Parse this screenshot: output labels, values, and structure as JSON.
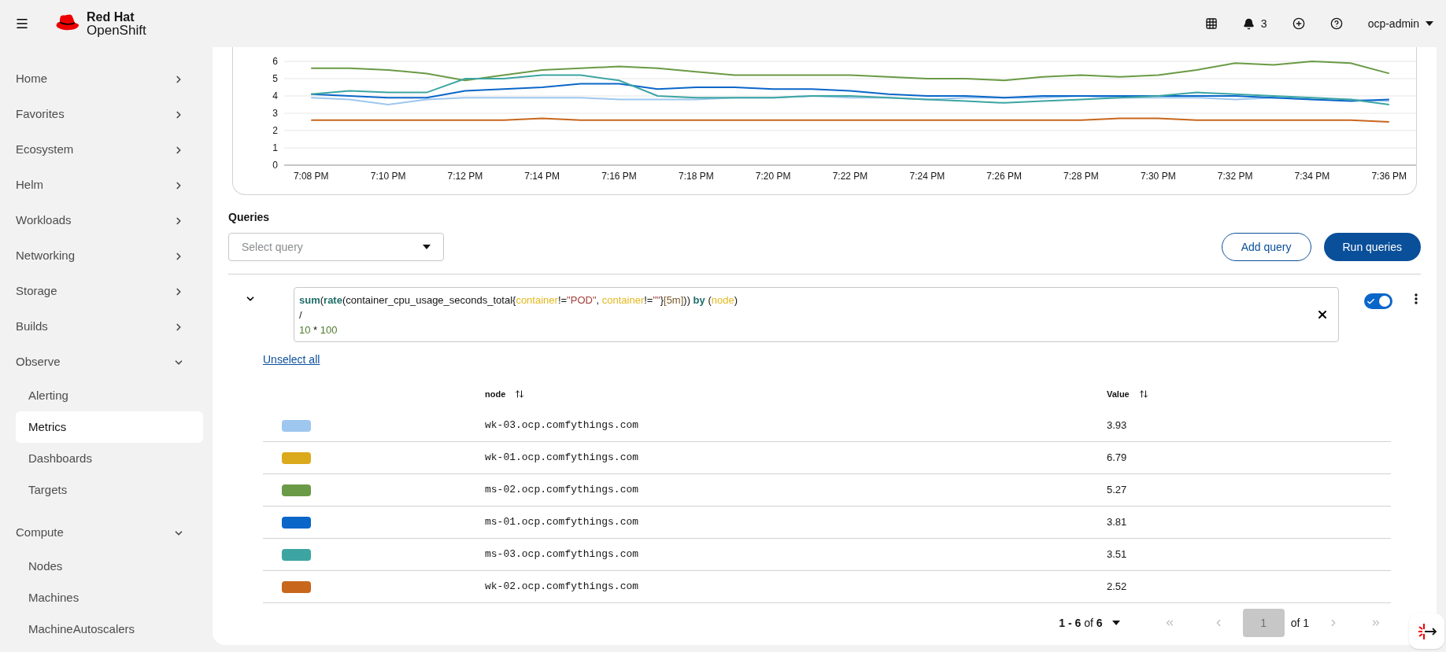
{
  "header": {
    "brand_top": "Red Hat",
    "brand_bottom": "OpenShift",
    "notifications": "3",
    "user": "ocp-admin"
  },
  "sidebar": {
    "items": [
      {
        "label": "Home",
        "expanded": false
      },
      {
        "label": "Favorites",
        "expanded": false
      },
      {
        "label": "Ecosystem",
        "expanded": false
      },
      {
        "label": "Helm",
        "expanded": false
      },
      {
        "label": "Workloads",
        "expanded": false
      },
      {
        "label": "Networking",
        "expanded": false
      },
      {
        "label": "Storage",
        "expanded": false
      },
      {
        "label": "Builds",
        "expanded": false
      },
      {
        "label": "Observe",
        "expanded": true,
        "children": [
          {
            "label": "Alerting",
            "selected": false
          },
          {
            "label": "Metrics",
            "selected": true
          },
          {
            "label": "Dashboards",
            "selected": false
          },
          {
            "label": "Targets",
            "selected": false
          }
        ]
      },
      {
        "label": "Compute",
        "expanded": true,
        "children": [
          {
            "label": "Nodes",
            "selected": false
          },
          {
            "label": "Machines",
            "selected": false
          },
          {
            "label": "MachineAutoscalers",
            "selected": false
          }
        ]
      }
    ]
  },
  "chart": {
    "chart_data": {
      "type": "line",
      "grid": true,
      "ylim": [
        0,
        6
      ],
      "yticks": [
        0,
        1,
        2,
        3,
        4,
        5,
        6
      ],
      "categories": [
        "7:08 PM",
        null,
        "7:10 PM",
        null,
        "7:12 PM",
        null,
        "7:14 PM",
        null,
        "7:16 PM",
        null,
        "7:18 PM",
        null,
        "7:20 PM",
        null,
        "7:22 PM",
        null,
        "7:24 PM",
        null,
        "7:26 PM",
        null,
        "7:28 PM",
        null,
        "7:30 PM",
        null,
        "7:32 PM",
        null,
        "7:34 PM",
        null,
        "7:36 PM"
      ],
      "series": [
        {
          "color": "#9ec7ef",
          "values": [
            3.9,
            3.8,
            3.5,
            3.8,
            3.9,
            3.9,
            3.9,
            3.9,
            3.8,
            3.8,
            3.8,
            3.9,
            3.9,
            4.0,
            3.9,
            3.9,
            3.8,
            3.9,
            3.9,
            3.9,
            4.0,
            3.9,
            3.9,
            3.9,
            3.8,
            3.9,
            3.8,
            3.8,
            3.7
          ]
        },
        {
          "color": "#6a9a45",
          "values": [
            5.6,
            5.6,
            5.5,
            5.3,
            4.9,
            5.2,
            5.5,
            5.6,
            5.7,
            5.6,
            5.4,
            5.2,
            5.2,
            5.2,
            5.2,
            5.1,
            5.0,
            5.0,
            4.9,
            5.1,
            5.2,
            5.1,
            5.2,
            5.5,
            5.9,
            5.8,
            6.0,
            5.9,
            5.3
          ]
        },
        {
          "color": "#0a66c9",
          "values": [
            4.1,
            4.0,
            3.9,
            3.9,
            4.3,
            4.4,
            4.5,
            4.7,
            4.7,
            4.4,
            4.5,
            4.5,
            4.4,
            4.4,
            4.3,
            4.1,
            4.0,
            4.0,
            3.9,
            4.0,
            4.0,
            4.0,
            4.0,
            4.0,
            4.0,
            3.9,
            3.8,
            3.7,
            3.8
          ]
        },
        {
          "color": "#3ca5a2",
          "values": [
            4.1,
            4.3,
            4.2,
            4.2,
            5.0,
            5.0,
            5.2,
            5.2,
            4.9,
            4.0,
            3.9,
            3.9,
            3.9,
            4.0,
            4.0,
            3.9,
            3.8,
            3.7,
            3.6,
            3.7,
            3.8,
            3.9,
            4.0,
            4.2,
            4.1,
            4.0,
            3.9,
            3.8,
            3.5
          ]
        },
        {
          "color": "#c8661c",
          "values": [
            2.6,
            2.6,
            2.6,
            2.6,
            2.6,
            2.6,
            2.7,
            2.6,
            2.6,
            2.6,
            2.6,
            2.6,
            2.6,
            2.6,
            2.6,
            2.6,
            2.6,
            2.6,
            2.6,
            2.6,
            2.6,
            2.7,
            2.7,
            2.6,
            2.6,
            2.6,
            2.6,
            2.6,
            2.5
          ]
        }
      ]
    }
  },
  "queries": {
    "label": "Queries",
    "select_placeholder": "Select query",
    "add_button": "Add query",
    "run_button": "Run queries",
    "query": {
      "expanded": true,
      "enabled": true,
      "lines": [
        [
          {
            "kind": "function",
            "text": "sum"
          },
          {
            "kind": "plain",
            "text": "("
          },
          {
            "kind": "function",
            "text": "rate"
          },
          {
            "kind": "plain",
            "text": "(container_cpu_usage_seconds_total{"
          },
          {
            "kind": "label",
            "text": "container"
          },
          {
            "kind": "plain",
            "text": "!="
          },
          {
            "kind": "string",
            "text": "\"POD\""
          },
          {
            "kind": "plain",
            "text": ", "
          },
          {
            "kind": "label",
            "text": "container"
          },
          {
            "kind": "plain",
            "text": "!="
          },
          {
            "kind": "string",
            "text": "\"\""
          },
          {
            "kind": "plain",
            "text": "}"
          },
          {
            "kind": "duration",
            "text": "[5m]"
          },
          {
            "kind": "plain",
            "text": ")) "
          },
          {
            "kind": "function",
            "text": "by"
          },
          {
            "kind": "plain",
            "text": " ("
          },
          {
            "kind": "label",
            "text": "node"
          },
          {
            "kind": "plain",
            "text": ")"
          }
        ],
        [
          {
            "kind": "plain",
            "text": "/"
          }
        ],
        [
          {
            "kind": "number",
            "text": "10"
          },
          {
            "kind": "plain",
            "text": " * "
          },
          {
            "kind": "number",
            "text": "100"
          }
        ]
      ]
    }
  },
  "results": {
    "unselect_all": "Unselect all",
    "columns": [
      "node",
      "Value"
    ],
    "rows": [
      {
        "color": "#9ec7ef",
        "node": "wk-03.ocp.comfythings.com",
        "value": "3.93"
      },
      {
        "color": "#dba91c",
        "node": "wk-01.ocp.comfythings.com",
        "value": "6.79"
      },
      {
        "color": "#6a9a45",
        "node": "ms-02.ocp.comfythings.com",
        "value": "5.27"
      },
      {
        "color": "#0a66c9",
        "node": "ms-01.ocp.comfythings.com",
        "value": "3.81"
      },
      {
        "color": "#3ca5a2",
        "node": "ms-03.ocp.comfythings.com",
        "value": "3.51"
      },
      {
        "color": "#c8661c",
        "node": "wk-02.ocp.comfythings.com",
        "value": "2.52"
      }
    ],
    "pagination": {
      "range": "**1 - 6** of **6**",
      "page": "1",
      "of": "of 1"
    }
  }
}
